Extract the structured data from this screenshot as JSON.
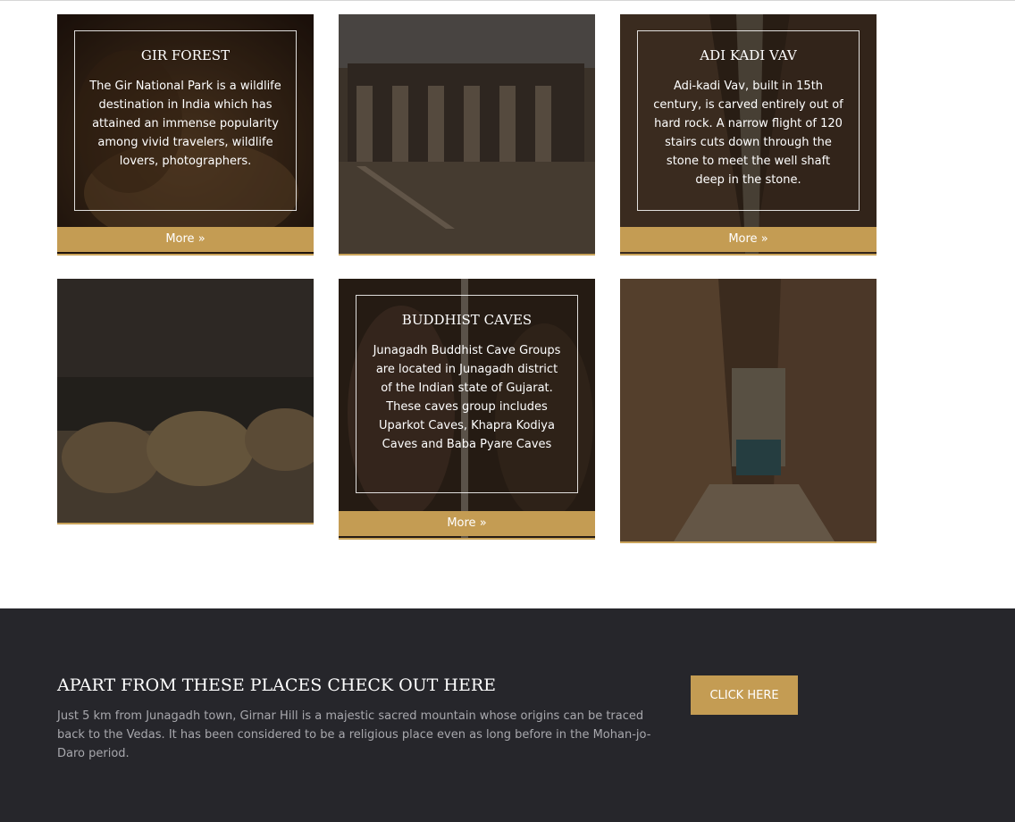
{
  "cards": [
    {
      "title": "GIR FOREST",
      "description": "The Gir National Park is a wildlife destination in India which has attained an immense popularity among vivid travelers, wildlife lovers, photographers.",
      "more_label": "More »"
    },
    {
      "title": "ADI KADI VAV",
      "description": "Adi-kadi Vav, built in 15th century, is carved entirely out of hard rock. A narrow flight of 120 stairs cuts down through the stone to meet the well shaft deep in the stone.",
      "more_label": "More »"
    },
    {
      "title": "BUDDHIST CAVES",
      "description": "Junagadh Buddhist Cave Groups are located in Junagadh district of the Indian state of Gujarat. These caves group includes Uparkot Caves, Khapra Kodiya Caves and Baba Pyare Caves",
      "more_label": "More »"
    }
  ],
  "footer": {
    "heading": "APART FROM THESE PLACES CHECK OUT HERE",
    "text": "Just 5 km from Junagadh town, Girnar Hill is a majestic sacred mountain whose origins can be traced back to the Vedas. It has been considered to be a religious place even as long before in the Mohan-jo-Daro period.",
    "button_label": "CLICK HERE"
  },
  "colors": {
    "accent": "#c49c53",
    "footer_bg": "#26262b"
  }
}
